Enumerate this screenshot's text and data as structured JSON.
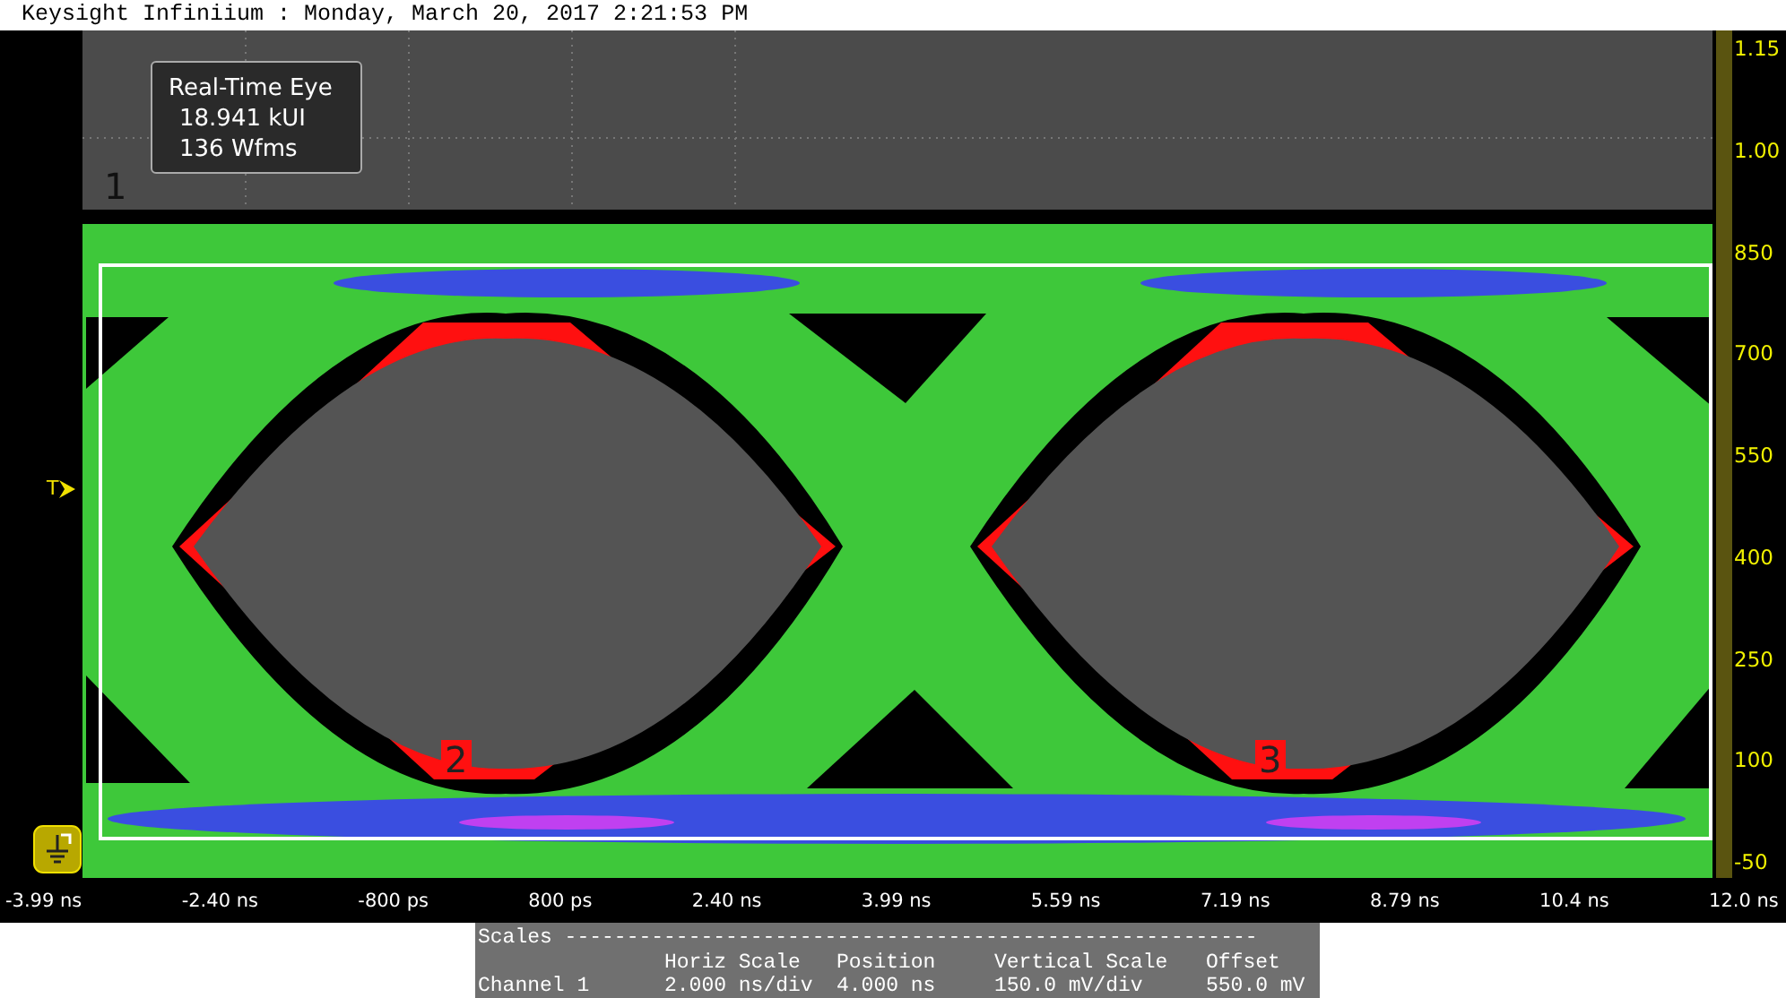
{
  "window": {
    "title": "Keysight Infiniium : Monday, March 20, 2017 2:21:53 PM"
  },
  "measurement": {
    "lines": [
      "Real-Time Eye",
      "18.941 kUI",
      "136 Wfms"
    ]
  },
  "markers": [
    {
      "label": "1",
      "kind": "channel"
    },
    {
      "label": "2",
      "kind": "mask"
    },
    {
      "label": "3",
      "kind": "mask"
    }
  ],
  "trigger": {
    "label": "T"
  },
  "y_axis": {
    "labels": [
      "1.15",
      "1.00",
      "850",
      "700",
      "550",
      "400",
      "250",
      "100",
      "-50"
    ]
  },
  "x_axis": {
    "labels": [
      "-3.99 ns",
      "-2.40 ns",
      "-800 ps",
      "800 ps",
      "2.40 ns",
      "3.99 ns",
      "5.59 ns",
      "7.19 ns",
      "8.79 ns",
      "10.4 ns",
      "12.0 ns"
    ]
  },
  "scales": {
    "heading": "Scales --------------------------------------------------------",
    "columns": [
      "",
      "Horiz Scale",
      "Position",
      "Vertical Scale",
      "Offset"
    ],
    "rows": [
      [
        "Channel 1",
        "2.000 ns/div",
        "4.000 ns",
        "150.0 mV/div",
        "550.0 mV"
      ]
    ]
  }
}
